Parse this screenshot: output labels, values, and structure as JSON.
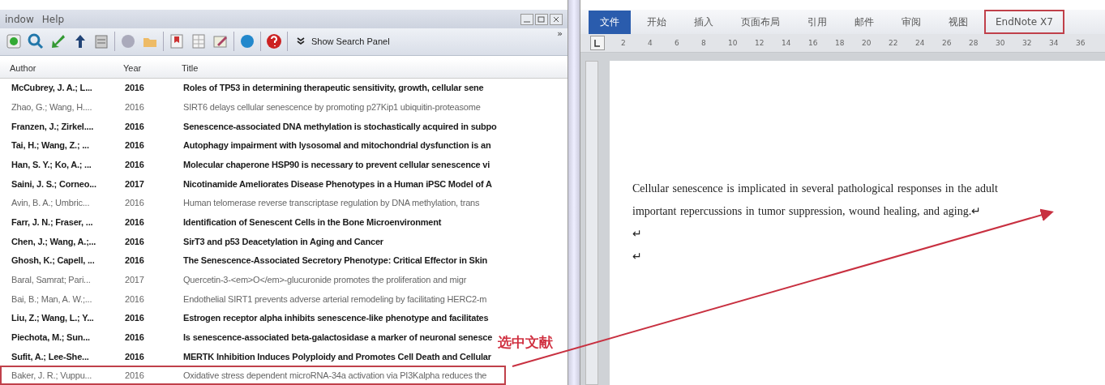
{
  "endnote": {
    "menu": [
      "indow",
      "Help"
    ],
    "toolbar_button": "Show Search Panel",
    "overflow": "»",
    "columns": [
      "Author",
      "Year",
      "Title"
    ],
    "rows": [
      {
        "author": "McCubrey, J. A.; L...",
        "year": "2016",
        "title": "Roles of TP53 in determining therapeutic sensitivity, growth, cellular sene",
        "unread": true,
        "marked": false
      },
      {
        "author": "Zhao, G.; Wang, H....",
        "year": "2016",
        "title": "SIRT6 delays cellular senescence by promoting p27Kip1 ubiquitin-proteasome",
        "unread": false,
        "marked": false
      },
      {
        "author": "Franzen, J.; Zirkel....",
        "year": "2016",
        "title": "Senescence-associated DNA methylation is stochastically acquired in subpo",
        "unread": true,
        "marked": false
      },
      {
        "author": "Tai, H.; Wang, Z.; ...",
        "year": "2016",
        "title": "Autophagy impairment with lysosomal and mitochondrial dysfunction is an",
        "unread": true,
        "marked": false
      },
      {
        "author": "Han, S. Y.; Ko, A.; ...",
        "year": "2016",
        "title": "Molecular chaperone HSP90 is necessary to prevent cellular senescence vi",
        "unread": true,
        "marked": false
      },
      {
        "author": "Saini, J. S.; Corneo...",
        "year": "2017",
        "title": "Nicotinamide Ameliorates Disease Phenotypes in a Human iPSC Model of A",
        "unread": true,
        "marked": false
      },
      {
        "author": "Avin, B. A.; Umbric...",
        "year": "2016",
        "title": "Human telomerase reverse transcriptase regulation by DNA methylation, trans",
        "unread": false,
        "marked": false
      },
      {
        "author": "Farr, J. N.; Fraser, ...",
        "year": "2016",
        "title": "Identification of Senescent Cells in the Bone Microenvironment",
        "unread": true,
        "marked": false
      },
      {
        "author": "Chen, J.; Wang, A.;...",
        "year": "2016",
        "title": "SirT3 and p53 Deacetylation in Aging and Cancer",
        "unread": true,
        "marked": false
      },
      {
        "author": "Ghosh, K.; Capell, ...",
        "year": "2016",
        "title": "The Senescence-Associated Secretory Phenotype: Critical Effector in Skin",
        "unread": true,
        "marked": false
      },
      {
        "author": "Baral, Samrat; Pari...",
        "year": "2017",
        "title": "Quercetin-3-<em>O</em>-glucuronide promotes the proliferation and migr",
        "unread": false,
        "marked": false
      },
      {
        "author": "Bai, B.; Man, A. W.;...",
        "year": "2016",
        "title": "Endothelial SIRT1 prevents adverse arterial remodeling by facilitating HERC2-m",
        "unread": false,
        "marked": false
      },
      {
        "author": "Liu, Z.; Wang, L.; Y...",
        "year": "2016",
        "title": "Estrogen receptor alpha inhibits senescence-like phenotype and facilitates",
        "unread": true,
        "marked": false
      },
      {
        "author": "Piechota, M.; Sun...",
        "year": "2016",
        "title": "Is senescence-associated beta-galactosidase a marker of neuronal senesce",
        "unread": true,
        "marked": false
      },
      {
        "author": "Sufit, A.; Lee-She...",
        "year": "2016",
        "title": "MERTK Inhibition Induces Polyploidy and Promotes Cell Death and Cellular",
        "unread": true,
        "marked": false
      },
      {
        "author": "Baker, J. R.; Vuppu...",
        "year": "2016",
        "title": "Oxidative stress dependent microRNA-34a activation via PI3Kalpha reduces the",
        "unread": false,
        "marked": true
      }
    ]
  },
  "word": {
    "tabs": [
      {
        "label": "文件",
        "selected": true,
        "marked": false
      },
      {
        "label": "开始",
        "selected": false,
        "marked": false
      },
      {
        "label": "插入",
        "selected": false,
        "marked": false
      },
      {
        "label": "页面布局",
        "selected": false,
        "marked": false
      },
      {
        "label": "引用",
        "selected": false,
        "marked": false
      },
      {
        "label": "邮件",
        "selected": false,
        "marked": false
      },
      {
        "label": "审阅",
        "selected": false,
        "marked": false
      },
      {
        "label": "视图",
        "selected": false,
        "marked": false
      },
      {
        "label": "EndNote X7",
        "selected": false,
        "marked": true
      }
    ],
    "ruler": [
      "2",
      "4",
      "6",
      "8",
      "10",
      "12",
      "14",
      "16",
      "18",
      "20",
      "22",
      "24",
      "26",
      "28",
      "30",
      "32",
      "34",
      "36"
    ],
    "lines": [
      "Cellular senescence is implicated in several pathological responses in the adult",
      "important repercussions in tumor suppression, wound healing, and aging.↵",
      "↵",
      "↵"
    ]
  },
  "annotation": {
    "label": "选中文献"
  }
}
